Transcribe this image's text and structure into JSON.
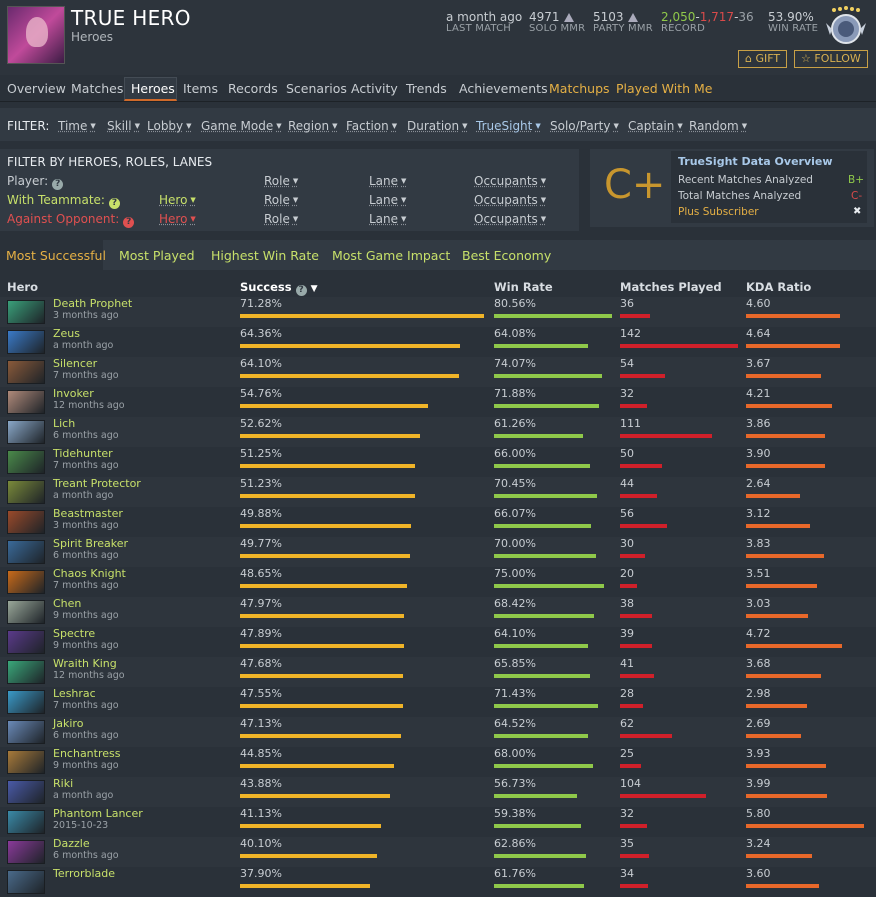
{
  "profile": {
    "name": "TRUE HERO",
    "subtitle": "Heroes"
  },
  "stats": {
    "last_match": {
      "value": "a month ago",
      "label": "LAST MATCH"
    },
    "solo_mmr": {
      "value": "4971",
      "label": "SOLO MMR"
    },
    "party_mmr": {
      "value": "5103",
      "label": "PARTY MMR"
    },
    "record": {
      "wins": "2,050",
      "sep1": "-",
      "losses": "1,717",
      "sep2": "-",
      "abandons": "36",
      "label": "RECORD"
    },
    "win_rate": {
      "value": "53.90%",
      "label": "WIN RATE"
    }
  },
  "buttons": {
    "gift": "GIFT",
    "follow": "FOLLOW"
  },
  "nav": [
    "Overview",
    "Matches",
    "Heroes",
    "Items",
    "Records",
    "Scenarios",
    "Activity",
    "Trends",
    "Achievements",
    "Matchups",
    "Played With Me"
  ],
  "filter": {
    "label": "FILTER:",
    "items": [
      "Time",
      "Skill",
      "Lobby",
      "Game Mode",
      "Region",
      "Faction",
      "Duration",
      "TrueSight",
      "Solo/Party",
      "Captain",
      "Random"
    ]
  },
  "hero_filter": {
    "title": "FILTER BY HEROES, ROLES, LANES",
    "player": "Player:",
    "with_teammate": "With Teammate:",
    "against_opponent": "Against Opponent:",
    "hero": "Hero",
    "role": "Role",
    "lane": "Lane",
    "occupants": "Occupants"
  },
  "truesight": {
    "grade": "C+",
    "title": "TrueSight Data Overview",
    "recent_label": "Recent Matches Analyzed",
    "recent_grade": "B+",
    "total_label": "Total Matches Analyzed",
    "total_grade": "C-",
    "plus": "Plus Subscriber",
    "close": "✖"
  },
  "tabs": [
    "Most Successful",
    "Most Played",
    "Highest Win Rate",
    "Most Game Impact",
    "Best Economy"
  ],
  "columns": {
    "hero": "Hero",
    "success": "Success",
    "win_rate": "Win Rate",
    "matches": "Matches Played",
    "kda": "KDA Ratio"
  },
  "colors": {
    "success_bar": "#f0b428",
    "winrate_bar": "#8fc84a",
    "matches_bar": "#d0202a",
    "kda_bar": "#e8682a"
  },
  "rows": [
    {
      "hero": "Death Prophet",
      "when": "3 months ago",
      "success": "71.28%",
      "s": 71.28,
      "wr": "80.56%",
      "w": 80.56,
      "mp": "36",
      "m": 36,
      "kda": "4.60",
      "k": 4.6,
      "icon": "#3aa07a"
    },
    {
      "hero": "Zeus",
      "when": "a month ago",
      "success": "64.36%",
      "s": 64.36,
      "wr": "64.08%",
      "w": 64.08,
      "mp": "142",
      "m": 142,
      "kda": "4.64",
      "k": 4.64,
      "icon": "#3a7ac8"
    },
    {
      "hero": "Silencer",
      "when": "7 months ago",
      "success": "64.10%",
      "s": 64.1,
      "wr": "74.07%",
      "w": 74.07,
      "mp": "54",
      "m": 54,
      "kda": "3.67",
      "k": 3.67,
      "icon": "#8a5a3a"
    },
    {
      "hero": "Invoker",
      "when": "12 months ago",
      "success": "54.76%",
      "s": 54.76,
      "wr": "71.88%",
      "w": 71.88,
      "mp": "32",
      "m": 32,
      "kda": "4.21",
      "k": 4.21,
      "icon": "#b08a7a"
    },
    {
      "hero": "Lich",
      "when": "6 months ago",
      "success": "52.62%",
      "s": 52.62,
      "wr": "61.26%",
      "w": 61.26,
      "mp": "111",
      "m": 111,
      "kda": "3.86",
      "k": 3.86,
      "icon": "#8aa8c8"
    },
    {
      "hero": "Tidehunter",
      "when": "7 months ago",
      "success": "51.25%",
      "s": 51.25,
      "wr": "66.00%",
      "w": 66.0,
      "mp": "50",
      "m": 50,
      "kda": "3.90",
      "k": 3.9,
      "icon": "#4a8a4a"
    },
    {
      "hero": "Treant Protector",
      "when": "a month ago",
      "success": "51.23%",
      "s": 51.23,
      "wr": "70.45%",
      "w": 70.45,
      "mp": "44",
      "m": 44,
      "kda": "2.64",
      "k": 2.64,
      "icon": "#7a8a3a"
    },
    {
      "hero": "Beastmaster",
      "when": "3 months ago",
      "success": "49.88%",
      "s": 49.88,
      "wr": "66.07%",
      "w": 66.07,
      "mp": "56",
      "m": 56,
      "kda": "3.12",
      "k": 3.12,
      "icon": "#9a4a2a"
    },
    {
      "hero": "Spirit Breaker",
      "when": "6 months ago",
      "success": "49.77%",
      "s": 49.77,
      "wr": "70.00%",
      "w": 70.0,
      "mp": "30",
      "m": 30,
      "kda": "3.83",
      "k": 3.83,
      "icon": "#3a6a9a"
    },
    {
      "hero": "Chaos Knight",
      "when": "7 months ago",
      "success": "48.65%",
      "s": 48.65,
      "wr": "75.00%",
      "w": 75.0,
      "mp": "20",
      "m": 20,
      "kda": "3.51",
      "k": 3.51,
      "icon": "#c86a1a"
    },
    {
      "hero": "Chen",
      "when": "9 months ago",
      "success": "47.97%",
      "s": 47.97,
      "wr": "68.42%",
      "w": 68.42,
      "mp": "38",
      "m": 38,
      "kda": "3.03",
      "k": 3.03,
      "icon": "#9aa89a"
    },
    {
      "hero": "Spectre",
      "when": "9 months ago",
      "success": "47.89%",
      "s": 47.89,
      "wr": "64.10%",
      "w": 64.1,
      "mp": "39",
      "m": 39,
      "kda": "4.72",
      "k": 4.72,
      "icon": "#5a3a8a"
    },
    {
      "hero": "Wraith King",
      "when": "12 months ago",
      "success": "47.68%",
      "s": 47.68,
      "wr": "65.85%",
      "w": 65.85,
      "mp": "41",
      "m": 41,
      "kda": "3.68",
      "k": 3.68,
      "icon": "#3aa87a"
    },
    {
      "hero": "Leshrac",
      "when": "7 months ago",
      "success": "47.55%",
      "s": 47.55,
      "wr": "71.43%",
      "w": 71.43,
      "mp": "28",
      "m": 28,
      "kda": "2.98",
      "k": 2.98,
      "icon": "#3a9ac8"
    },
    {
      "hero": "Jakiro",
      "when": "6 months ago",
      "success": "47.13%",
      "s": 47.13,
      "wr": "64.52%",
      "w": 64.52,
      "mp": "62",
      "m": 62,
      "kda": "2.69",
      "k": 2.69,
      "icon": "#6a8ab8"
    },
    {
      "hero": "Enchantress",
      "when": "9 months ago",
      "success": "44.85%",
      "s": 44.85,
      "wr": "68.00%",
      "w": 68.0,
      "mp": "25",
      "m": 25,
      "kda": "3.93",
      "k": 3.93,
      "icon": "#a87a3a"
    },
    {
      "hero": "Riki",
      "when": "a month ago",
      "success": "43.88%",
      "s": 43.88,
      "wr": "56.73%",
      "w": 56.73,
      "mp": "104",
      "m": 104,
      "kda": "3.99",
      "k": 3.99,
      "icon": "#4a5aa8"
    },
    {
      "hero": "Phantom Lancer",
      "when": "2015-10-23",
      "success": "41.13%",
      "s": 41.13,
      "wr": "59.38%",
      "w": 59.38,
      "mp": "32",
      "m": 32,
      "kda": "5.80",
      "k": 5.8,
      "icon": "#3a8aa8"
    },
    {
      "hero": "Dazzle",
      "when": "6 months ago",
      "success": "40.10%",
      "s": 40.1,
      "wr": "62.86%",
      "w": 62.86,
      "mp": "35",
      "m": 35,
      "kda": "3.24",
      "k": 3.24,
      "icon": "#8a3a9a"
    },
    {
      "hero": "Terrorblade",
      "when": "",
      "success": "37.90%",
      "s": 37.9,
      "wr": "61.76%",
      "w": 61.76,
      "mp": "34",
      "m": 34,
      "kda": "3.60",
      "k": 3.6,
      "icon": "#4a6a8a"
    }
  ]
}
